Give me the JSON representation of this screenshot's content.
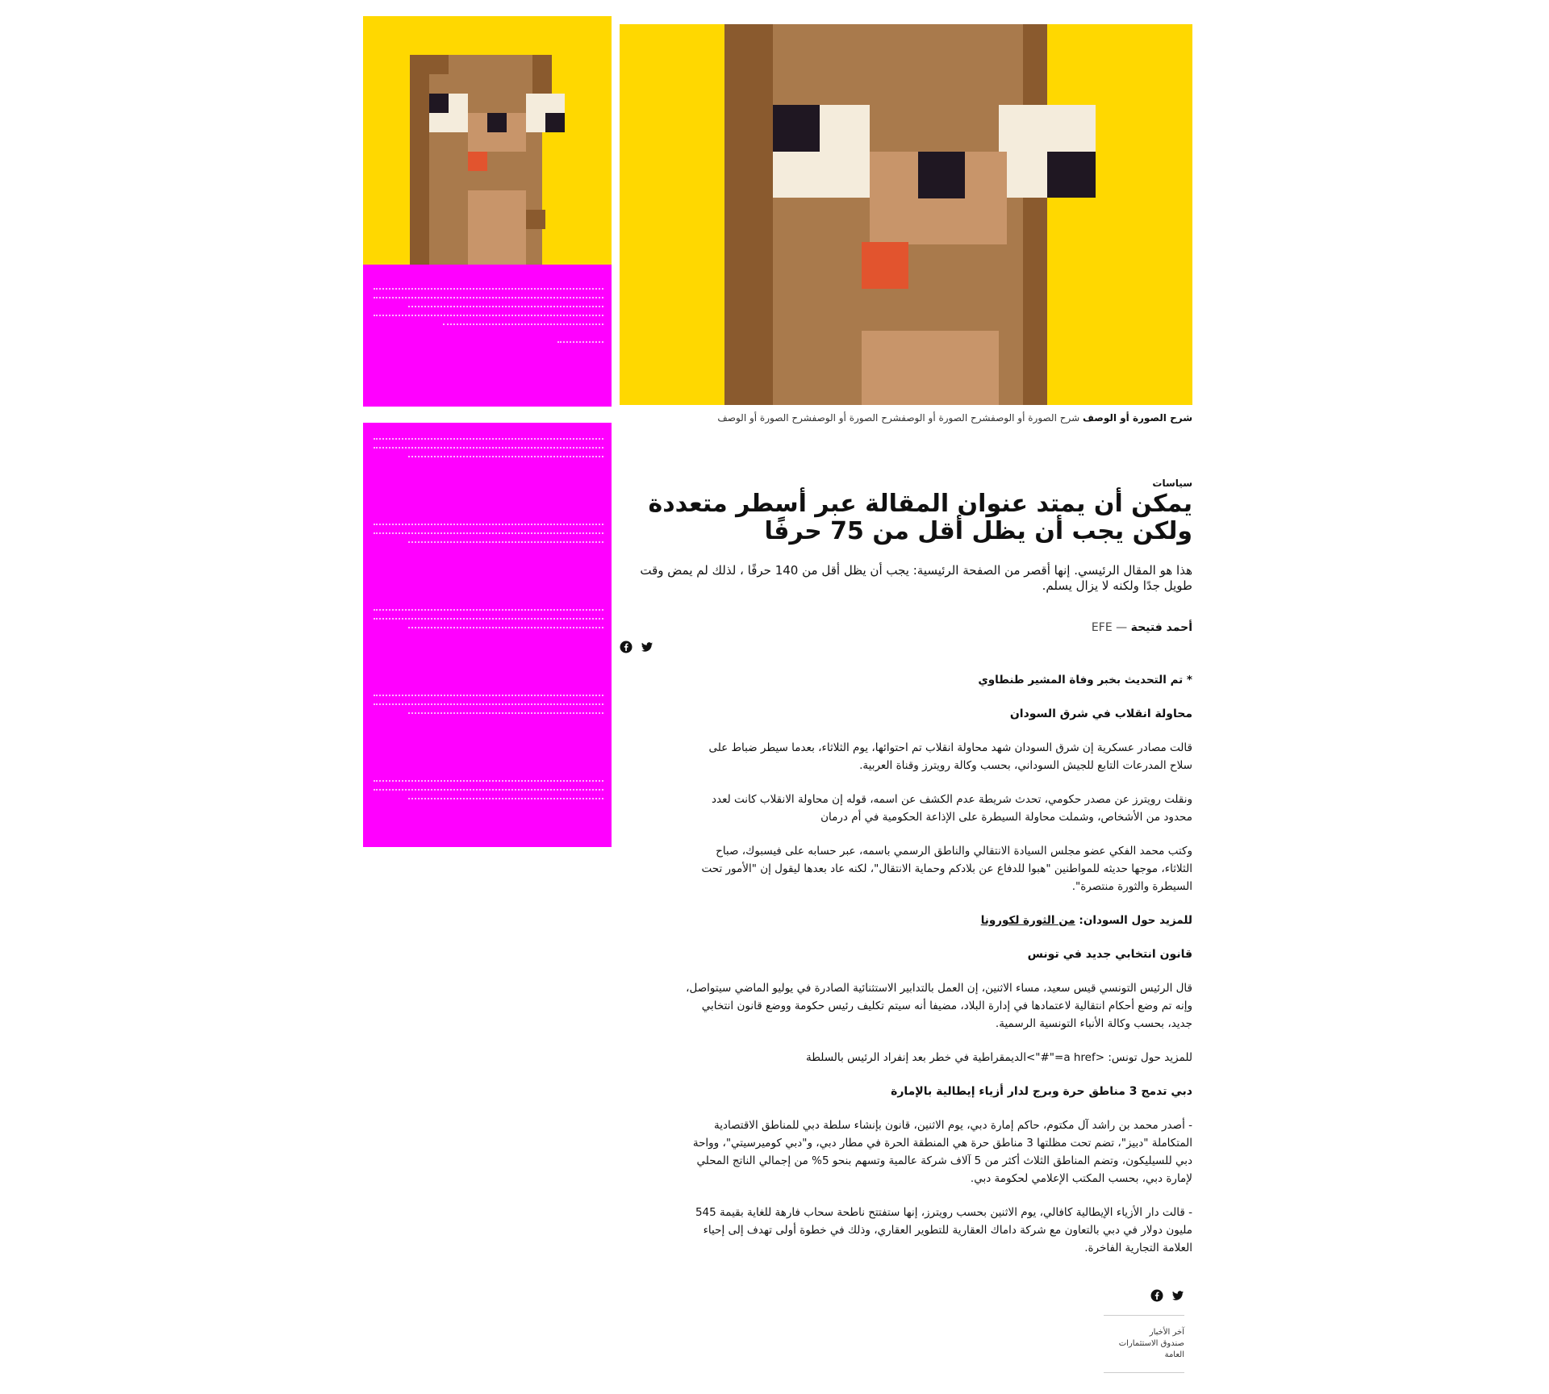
{
  "colors": {
    "ad_yellow": "#ffd800",
    "ad_magenta": "#ff00ff",
    "fur_dark": "#8a5a2e",
    "fur_mid": "#a97a4c",
    "fur_light": "#c8956a",
    "eye_white": "#f4ecdc",
    "eye_black": "#1f1722",
    "tongue": "#e2542e"
  },
  "caption": {
    "strong": "شرح الصورة أو الوصف",
    "rest": " شرح الصورة أو الوصفشرح الصورة أو الوصفشرح الصورة أو الوصفشرح الصورة أو الوصف"
  },
  "article": {
    "section": "سياسات",
    "title": "يمكن أن يمتد عنوان المقالة عبر أسطر متعددة ولكن يجب أن يظل أقل من 75 حرفًا",
    "summary": "هذا هو المقال الرئيسي. إنها أقصر من الصفحة الرئيسية: يجب أن يظل أقل من 140 حرفًا ، لذلك لم يمض وقت طويل جدًا ولكنه لا يزال يسلم.",
    "author": "أحمد فتيحة",
    "byline_separator": " — ",
    "agency": "EFE",
    "share_icons": [
      "facebook-icon",
      "twitter-icon"
    ],
    "body": {
      "update_note": "* تم التحديث بخبر وفاة المشير طنطاوي",
      "h1": "محاولة انقلاب في شرق السودان",
      "p1": "قالت مصادر عسكرية إن شرق السودان شهد محاولة انقلاب تم احتوائها، يوم الثلاثاء، بعدما سيطر ضباط على سلاح المدرعات التابع للجيش السوداني، بحسب وكالة رويترز وقناة العربية.",
      "p2": "ونقلت رويترز عن مصدر حكومي، تحدث شريطة عدم الكشف عن اسمه، قوله إن محاولة الانقلاب كانت لعدد محدود من الأشخاص، وشملت محاولة السيطرة على الإذاعة الحكومية في أم درمان",
      "p3": "وكتب محمد الفكي عضو مجلس السيادة الانتقالي والناطق الرسمي باسمه، عبر حسابه على فيسبوك، صباح الثلاثاء، موجها حديثه للمواطنين \"هبوا للدفاع عن بلادكم وحماية الانتقال\"، لكنه عاد بعدها ليقول إن \"الأمور تحت السيطرة والثورة منتصرة\".",
      "more_sudan_label": "للمزيد حول السودان: ",
      "more_sudan_link": "من الثورة لكورونا",
      "h2": "قانون انتخابي جديد في تونس",
      "p4": "قال الرئيس التونسي قيس سعيد، مساء الاثنين، إن العمل بالتدابير الاستثنائية الصادرة في يوليو الماضي سيتواصل، وإنه تم وضع أحكام انتقالية لاعتمادها في إدارة البلاد، مضيفا أنه سيتم تكليف رئيس حكومة ووضع قانون انتخابي جديد، بحسب وكالة الأنباء التونسية الرسمية.",
      "more_tunisia": "للمزيد حول تونس: <a href=\"#\">الديمقراطية في خطر بعد إنفراد الرئيس بالسلطة",
      "h3": "دبي تدمج 3 مناطق حرة وبرج لدار أزياء إيطالية بالإمارة",
      "p5": "- أصدر محمد بن راشد آل مكتوم، حاكم إمارة دبي، يوم الاثنين، قانون بإنشاء سلطة دبي للمناطق الاقتصادية المتكاملة \"دبيز\"، تضم تحت مظلتها 3 مناطق حرة هي المنطقة الحرة في مطار دبي، و\"دبي كوميرسيتي\"، وواحة دبي للسيليكون، وتضم المناطق الثلاث أكثر من 5 آلاف شركة عالمية وتسهم بنحو 5% من إجمالي الناتج المحلي لإمارة دبي، بحسب المكتب الإعلامي لحكومة دبي.",
      "p6": "- قالت دار الأزياء الإيطالية كافالي، يوم الاثنين بحسب رويترز، إنها ستفتتح ناطحة سحاب فارهة للغاية بقيمة 545 مليون دولار في دبي بالتعاون مع شركة داماك العقارية للتطوير العقاري، وذلك في خطوة أولى تهدف إلى إحياء العلامة التجارية الفاخرة."
    }
  },
  "related": {
    "line1": "آخر الأخبار",
    "line2": "صندوق الاستثمارات",
    "line3": "العامة"
  }
}
